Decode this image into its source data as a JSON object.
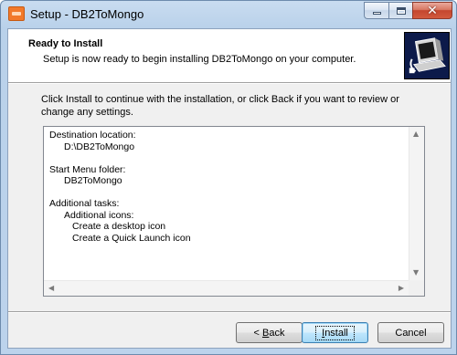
{
  "window": {
    "title": "Setup - DB2ToMongo",
    "minimize_glyph": "",
    "close_glyph": "✕"
  },
  "header": {
    "title": "Ready to Install",
    "subtitle": "Setup is now ready to begin installing DB2ToMongo on your computer."
  },
  "intro": {
    "text": "Click Install to continue with the installation, or click Back if you want to review or change any settings."
  },
  "memo": {
    "destination_label": "Destination location:",
    "destination_value": "D:\\DB2ToMongo",
    "start_menu_label": "Start Menu folder:",
    "start_menu_value": "DB2ToMongo",
    "additional_tasks_label": "Additional tasks:",
    "additional_icons_label": "Additional icons:",
    "tasks": [
      "Create a desktop icon",
      "Create a Quick Launch icon"
    ]
  },
  "buttons": {
    "back_prefix": "< ",
    "back_accel": "B",
    "back_rest": "ack",
    "install_accel": "I",
    "install_rest": "nstall",
    "cancel": "Cancel"
  },
  "icons": {
    "app": "installer-app-icon",
    "wizard": "computer-install-image"
  }
}
